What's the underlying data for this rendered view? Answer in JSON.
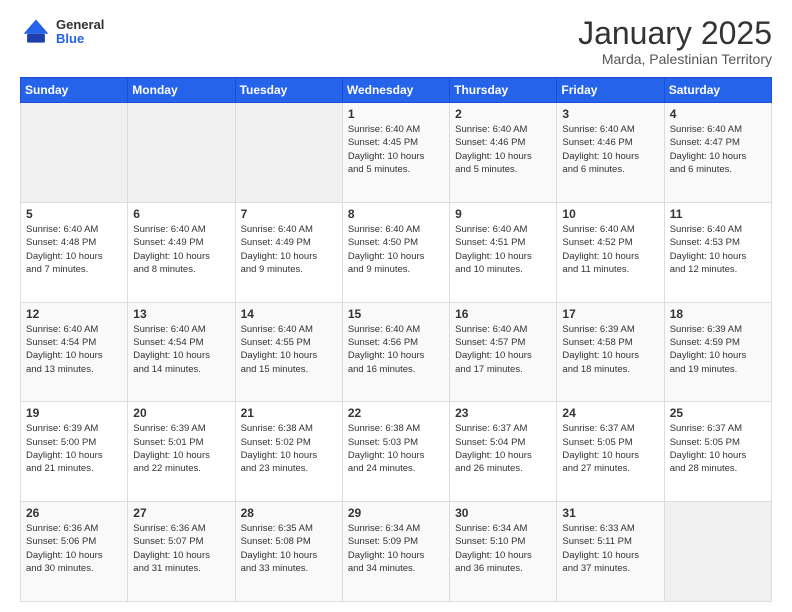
{
  "header": {
    "logo_general": "General",
    "logo_blue": "Blue",
    "title": "January 2025",
    "subtitle": "Marda, Palestinian Territory"
  },
  "weekdays": [
    "Sunday",
    "Monday",
    "Tuesday",
    "Wednesday",
    "Thursday",
    "Friday",
    "Saturday"
  ],
  "weeks": [
    [
      {
        "num": "",
        "info": ""
      },
      {
        "num": "",
        "info": ""
      },
      {
        "num": "",
        "info": ""
      },
      {
        "num": "1",
        "info": "Sunrise: 6:40 AM\nSunset: 4:45 PM\nDaylight: 10 hours\nand 5 minutes."
      },
      {
        "num": "2",
        "info": "Sunrise: 6:40 AM\nSunset: 4:46 PM\nDaylight: 10 hours\nand 5 minutes."
      },
      {
        "num": "3",
        "info": "Sunrise: 6:40 AM\nSunset: 4:46 PM\nDaylight: 10 hours\nand 6 minutes."
      },
      {
        "num": "4",
        "info": "Sunrise: 6:40 AM\nSunset: 4:47 PM\nDaylight: 10 hours\nand 6 minutes."
      }
    ],
    [
      {
        "num": "5",
        "info": "Sunrise: 6:40 AM\nSunset: 4:48 PM\nDaylight: 10 hours\nand 7 minutes."
      },
      {
        "num": "6",
        "info": "Sunrise: 6:40 AM\nSunset: 4:49 PM\nDaylight: 10 hours\nand 8 minutes."
      },
      {
        "num": "7",
        "info": "Sunrise: 6:40 AM\nSunset: 4:49 PM\nDaylight: 10 hours\nand 9 minutes."
      },
      {
        "num": "8",
        "info": "Sunrise: 6:40 AM\nSunset: 4:50 PM\nDaylight: 10 hours\nand 9 minutes."
      },
      {
        "num": "9",
        "info": "Sunrise: 6:40 AM\nSunset: 4:51 PM\nDaylight: 10 hours\nand 10 minutes."
      },
      {
        "num": "10",
        "info": "Sunrise: 6:40 AM\nSunset: 4:52 PM\nDaylight: 10 hours\nand 11 minutes."
      },
      {
        "num": "11",
        "info": "Sunrise: 6:40 AM\nSunset: 4:53 PM\nDaylight: 10 hours\nand 12 minutes."
      }
    ],
    [
      {
        "num": "12",
        "info": "Sunrise: 6:40 AM\nSunset: 4:54 PM\nDaylight: 10 hours\nand 13 minutes."
      },
      {
        "num": "13",
        "info": "Sunrise: 6:40 AM\nSunset: 4:54 PM\nDaylight: 10 hours\nand 14 minutes."
      },
      {
        "num": "14",
        "info": "Sunrise: 6:40 AM\nSunset: 4:55 PM\nDaylight: 10 hours\nand 15 minutes."
      },
      {
        "num": "15",
        "info": "Sunrise: 6:40 AM\nSunset: 4:56 PM\nDaylight: 10 hours\nand 16 minutes."
      },
      {
        "num": "16",
        "info": "Sunrise: 6:40 AM\nSunset: 4:57 PM\nDaylight: 10 hours\nand 17 minutes."
      },
      {
        "num": "17",
        "info": "Sunrise: 6:39 AM\nSunset: 4:58 PM\nDaylight: 10 hours\nand 18 minutes."
      },
      {
        "num": "18",
        "info": "Sunrise: 6:39 AM\nSunset: 4:59 PM\nDaylight: 10 hours\nand 19 minutes."
      }
    ],
    [
      {
        "num": "19",
        "info": "Sunrise: 6:39 AM\nSunset: 5:00 PM\nDaylight: 10 hours\nand 21 minutes."
      },
      {
        "num": "20",
        "info": "Sunrise: 6:39 AM\nSunset: 5:01 PM\nDaylight: 10 hours\nand 22 minutes."
      },
      {
        "num": "21",
        "info": "Sunrise: 6:38 AM\nSunset: 5:02 PM\nDaylight: 10 hours\nand 23 minutes."
      },
      {
        "num": "22",
        "info": "Sunrise: 6:38 AM\nSunset: 5:03 PM\nDaylight: 10 hours\nand 24 minutes."
      },
      {
        "num": "23",
        "info": "Sunrise: 6:37 AM\nSunset: 5:04 PM\nDaylight: 10 hours\nand 26 minutes."
      },
      {
        "num": "24",
        "info": "Sunrise: 6:37 AM\nSunset: 5:05 PM\nDaylight: 10 hours\nand 27 minutes."
      },
      {
        "num": "25",
        "info": "Sunrise: 6:37 AM\nSunset: 5:05 PM\nDaylight: 10 hours\nand 28 minutes."
      }
    ],
    [
      {
        "num": "26",
        "info": "Sunrise: 6:36 AM\nSunset: 5:06 PM\nDaylight: 10 hours\nand 30 minutes."
      },
      {
        "num": "27",
        "info": "Sunrise: 6:36 AM\nSunset: 5:07 PM\nDaylight: 10 hours\nand 31 minutes."
      },
      {
        "num": "28",
        "info": "Sunrise: 6:35 AM\nSunset: 5:08 PM\nDaylight: 10 hours\nand 33 minutes."
      },
      {
        "num": "29",
        "info": "Sunrise: 6:34 AM\nSunset: 5:09 PM\nDaylight: 10 hours\nand 34 minutes."
      },
      {
        "num": "30",
        "info": "Sunrise: 6:34 AM\nSunset: 5:10 PM\nDaylight: 10 hours\nand 36 minutes."
      },
      {
        "num": "31",
        "info": "Sunrise: 6:33 AM\nSunset: 5:11 PM\nDaylight: 10 hours\nand 37 minutes."
      },
      {
        "num": "",
        "info": ""
      }
    ]
  ]
}
